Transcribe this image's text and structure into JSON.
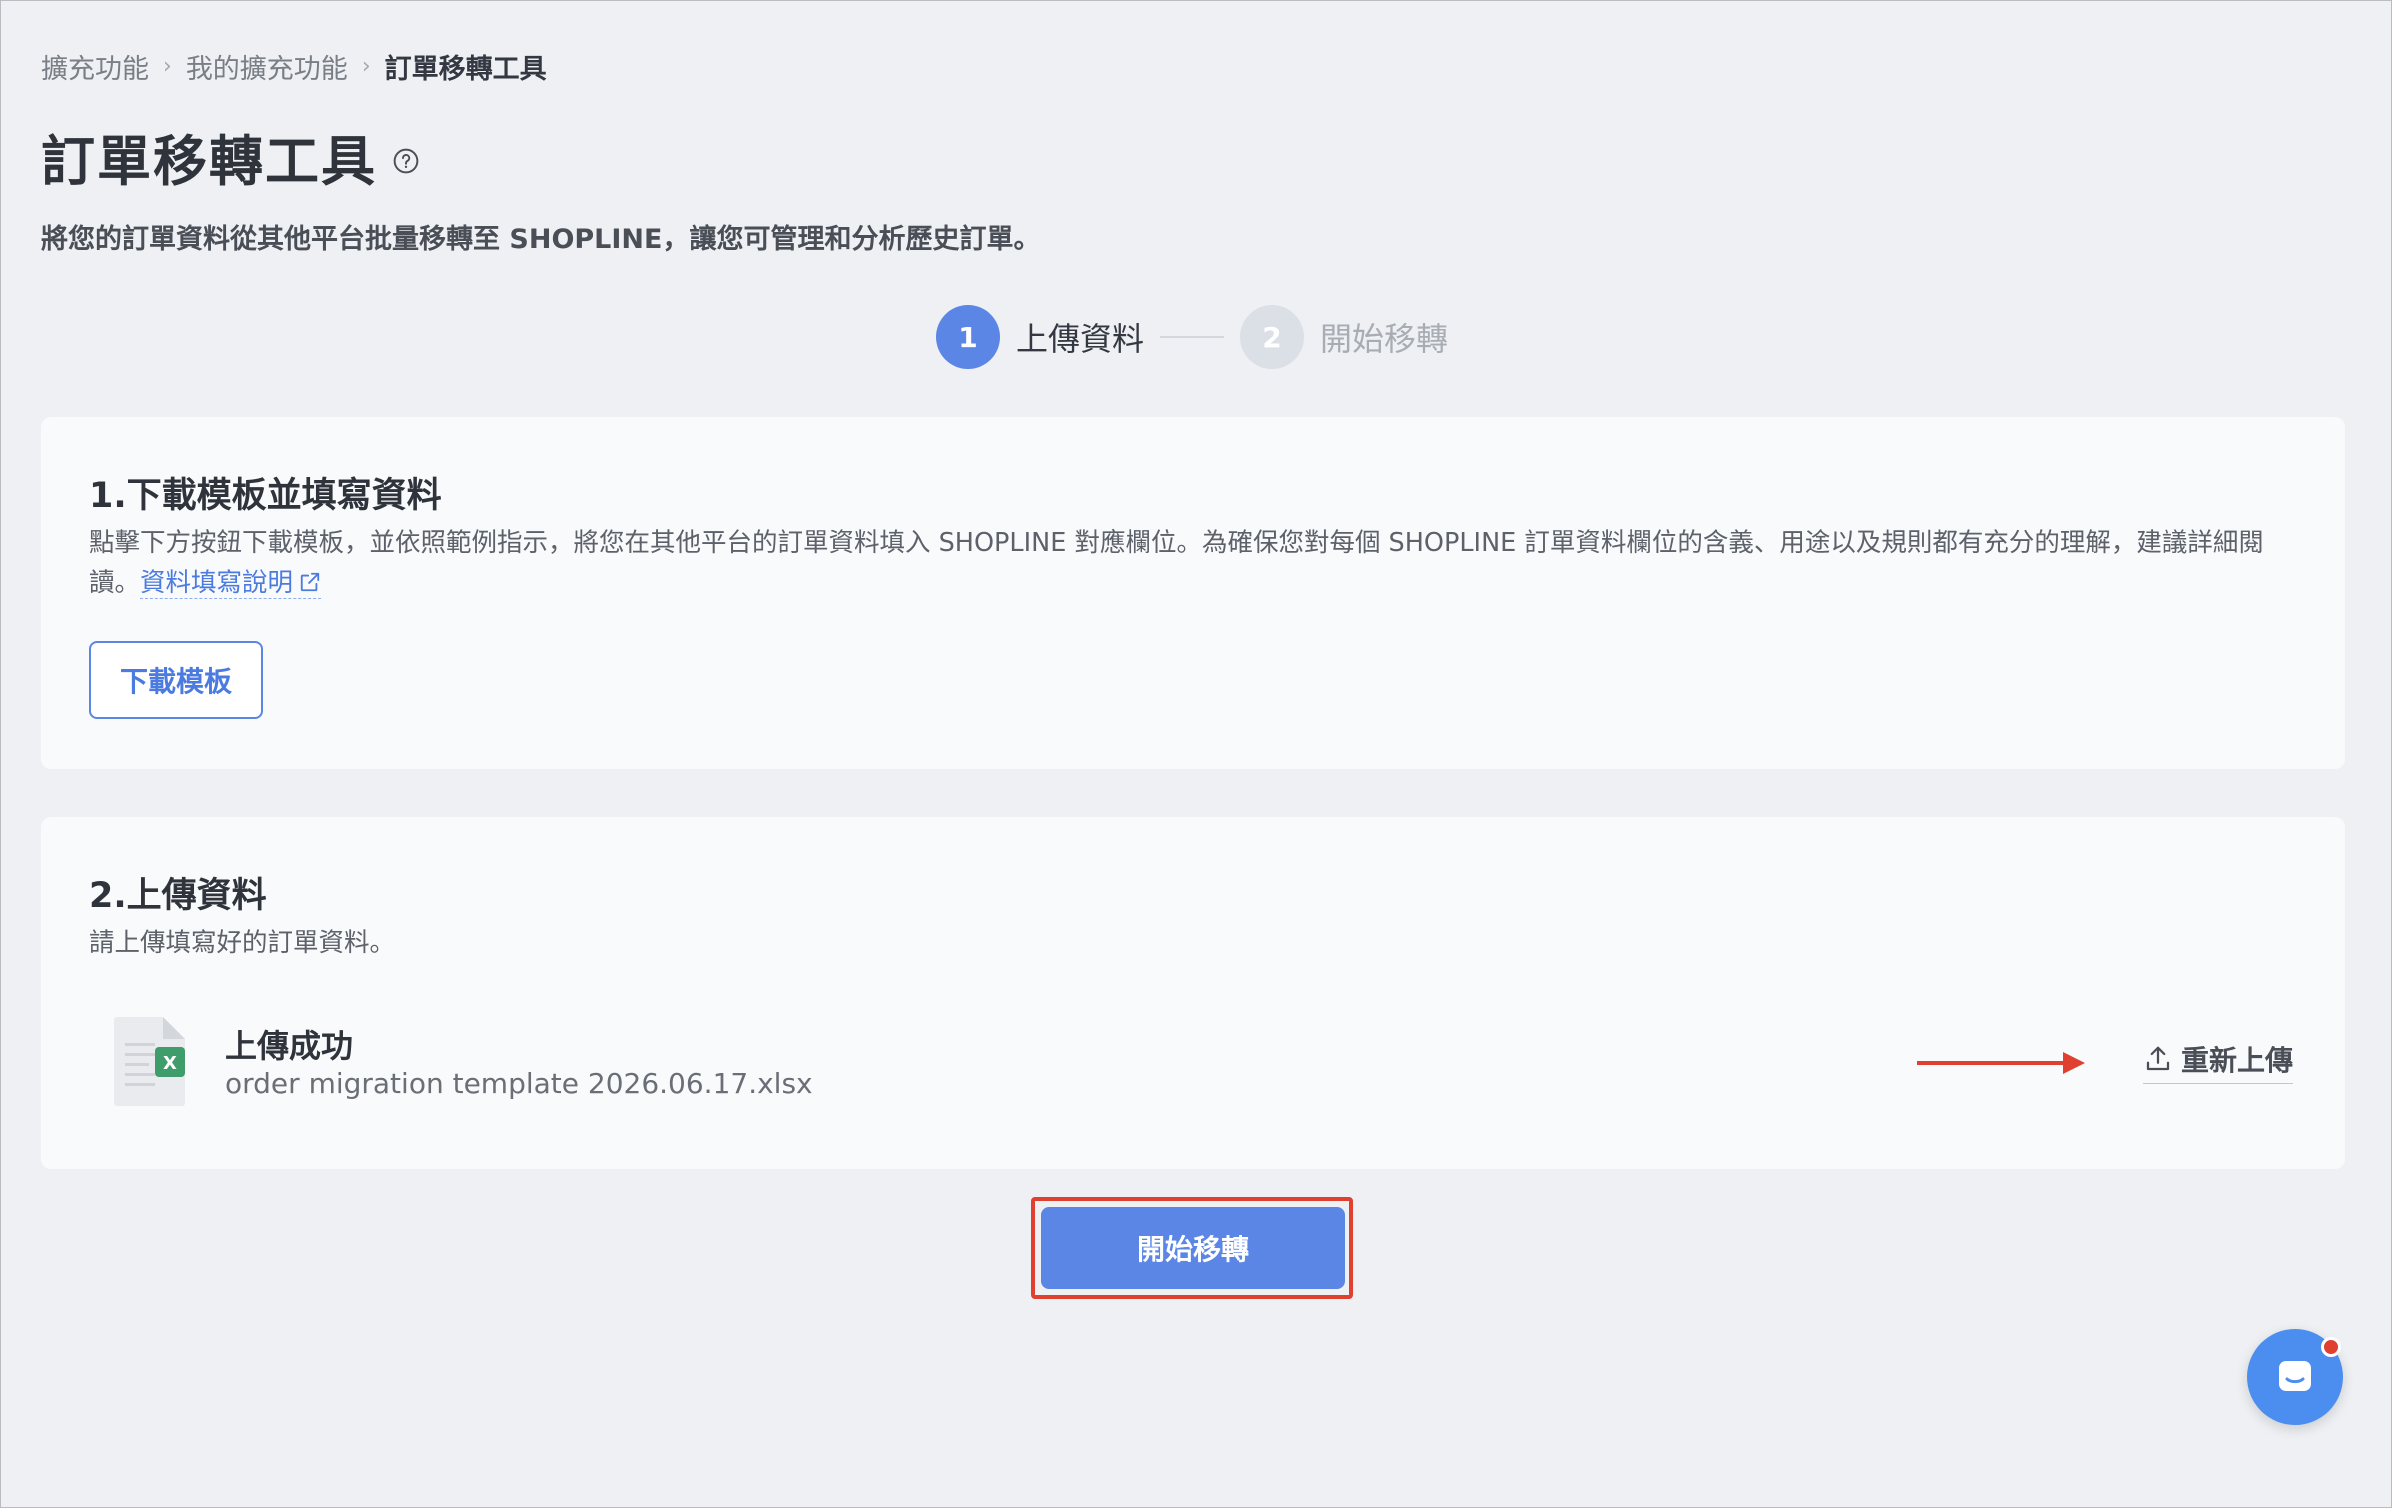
{
  "breadcrumb": {
    "items": [
      "擴充功能",
      "我的擴充功能",
      "訂單移轉工具"
    ],
    "separator": "›"
  },
  "header": {
    "title": "訂單移轉工具",
    "subtitle": "將您的訂單資料從其他平台批量移轉至 SHOPLINE，讓您可管理和分析歷史訂單。"
  },
  "stepper": {
    "steps": [
      {
        "number": "1",
        "label": "上傳資料",
        "state": "active"
      },
      {
        "number": "2",
        "label": "開始移轉",
        "state": "inactive"
      }
    ]
  },
  "download_section": {
    "title": "1.下載模板並填寫資料",
    "description": "點擊下方按鈕下載模板，並依照範例指示，將您在其他平台的訂單資料填入 SHOPLINE 對應欄位。為確保您對每個 SHOPLINE 訂單資料欄位的含義、用途以及規則都有充分的理解，建議詳細閱讀。",
    "link_text": "資料填寫說明",
    "button_label": "下載模板"
  },
  "upload_section": {
    "title": "2.上傳資料",
    "description": "請上傳填寫好的訂單資料。",
    "status": "上傳成功",
    "file_name": "order migration template 2026.06.17.xlsx",
    "reupload_label": "重新上傳",
    "file_badge": "X"
  },
  "actions": {
    "start_label": "開始移轉"
  },
  "colors": {
    "primary": "#5b86e5",
    "annotation": "#e0402f",
    "excel_green": "#3f9c6b",
    "chat_blue": "#4b8ef0"
  },
  "icons": {
    "help": "question-circle-icon",
    "external_link": "external-link-icon",
    "file": "excel-file-icon",
    "upload": "upload-icon",
    "chat": "chat-icon"
  }
}
